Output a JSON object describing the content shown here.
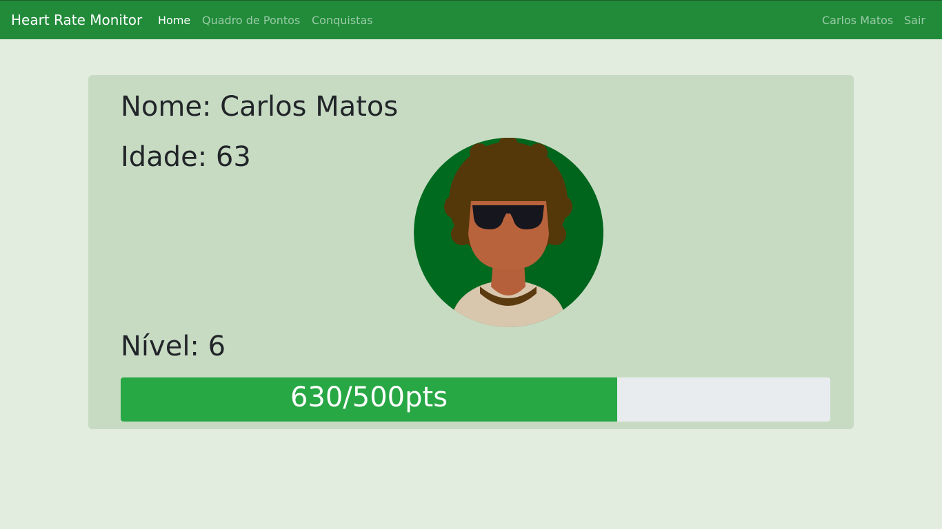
{
  "navbar": {
    "brand": "Heart Rate Monitor",
    "links": [
      {
        "label": "Home",
        "active": true
      },
      {
        "label": "Quadro de Pontos",
        "active": false
      },
      {
        "label": "Conquistas",
        "active": false
      }
    ],
    "user_name": "Carlos Matos",
    "logout_label": "Sair"
  },
  "profile": {
    "name_text": "Nome: Carlos Matos",
    "age_text": "Idade: 63",
    "level_text": "Nível: 6",
    "avatar_icon": "user-avatar-afro-sunglasses"
  },
  "progress": {
    "label": "630/500pts",
    "fill_fraction": 0.7
  },
  "colors": {
    "navbar_bg": "#218b3a",
    "page_bg": "#e2ecdf",
    "card_bg": "#c7dbc3",
    "progress_fill": "#28a745",
    "progress_track": "#e9ecef"
  }
}
